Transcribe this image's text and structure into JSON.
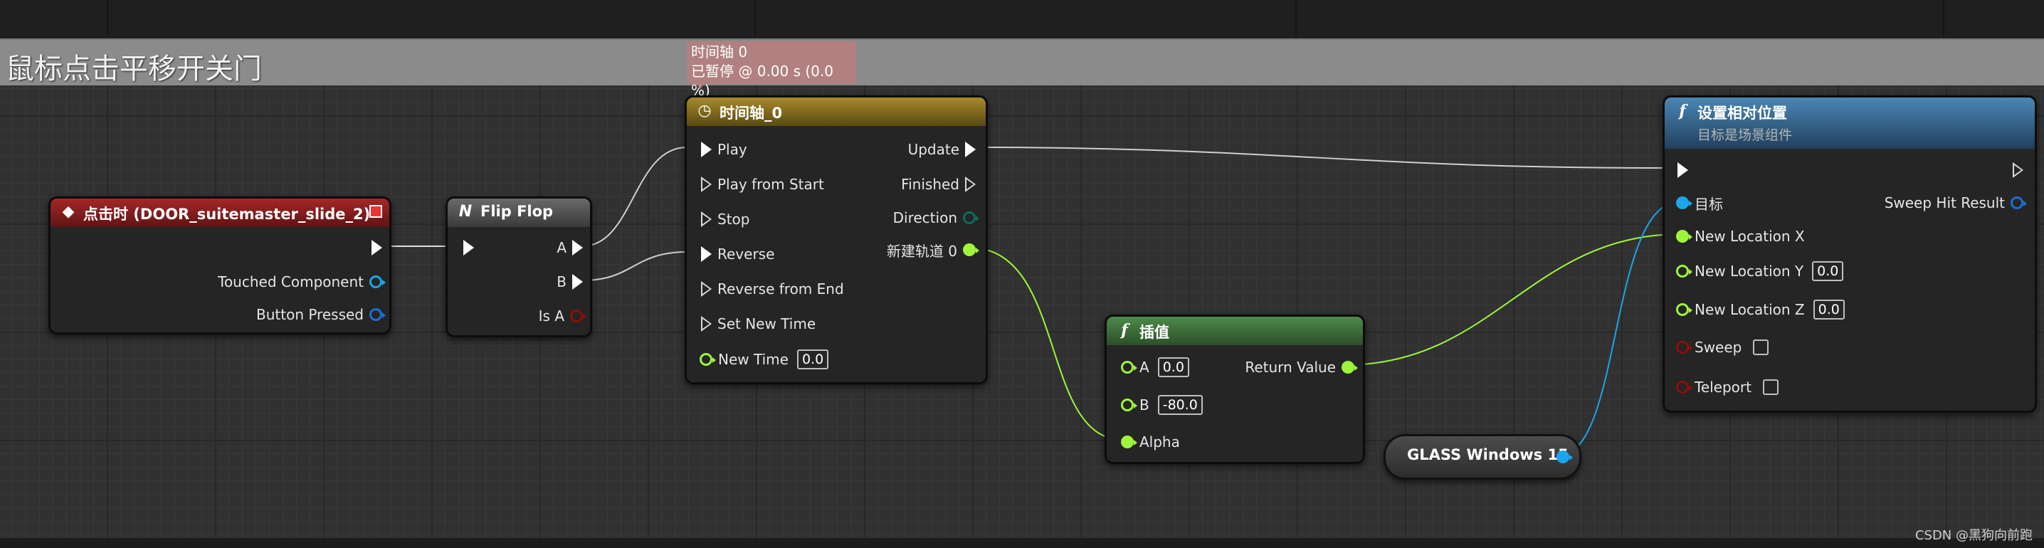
{
  "comment": {
    "title": "鼠标点击平移开关门"
  },
  "event_node": {
    "title": "点击时 (DOOR_suitemaster_slide_2)",
    "pins": {
      "touched": "Touched Component",
      "pressed": "Button Pressed"
    }
  },
  "flipflop_node": {
    "title": "Flip Flop",
    "pins": {
      "a": "A",
      "b": "B",
      "is_a": "Is A"
    }
  },
  "timeline_tooltip": {
    "line1": "时间轴 0",
    "line2": "已暂停 @ 0.00 s (0.0 %)"
  },
  "timeline_node": {
    "title": "时间轴_0",
    "inputs": {
      "play": "Play",
      "play_from_start": "Play from Start",
      "stop": "Stop",
      "reverse": "Reverse",
      "reverse_from_end": "Reverse from End",
      "set_new_time": "Set New Time",
      "new_time": "New Time",
      "new_time_value": "0.0"
    },
    "outputs": {
      "update": "Update",
      "finished": "Finished",
      "direction": "Direction",
      "track": "新建轨道 0"
    }
  },
  "lerp_node": {
    "title": "插值",
    "inputs": {
      "a": "A",
      "a_value": "0.0",
      "b": "B",
      "b_value": "-80.0",
      "alpha": "Alpha"
    },
    "outputs": {
      "return": "Return Value"
    }
  },
  "var_node": {
    "label": "GLASS Windows 15"
  },
  "setloc_node": {
    "title": "设置相对位置",
    "subtitle": "目标是场景组件",
    "inputs": {
      "target": "目标",
      "new_x": "New Location X",
      "new_y": "New Location Y",
      "new_y_value": "0.0",
      "new_z": "New Location Z",
      "new_z_value": "0.0",
      "sweep": "Sweep",
      "teleport": "Teleport"
    },
    "outputs": {
      "sweep_hit": "Sweep Hit Result"
    }
  },
  "watermark": "CSDN @黑狗向前跑",
  "colors": {
    "exec": "#ffffff",
    "float": "#9ff53a",
    "object": "#1aa6ea",
    "bool": "#8c0e0e",
    "struct": "#1a6fd6",
    "event_header": "#8e1c1c",
    "timeline_header": "#8a7320",
    "lerp_header": "#3f6d3c",
    "setloc_header": "#2f5d86"
  },
  "icons": {
    "event": "event-diamond-icon",
    "flipflop": "macro-n-icon",
    "timeline": "clock-icon",
    "function": "function-f-icon"
  }
}
